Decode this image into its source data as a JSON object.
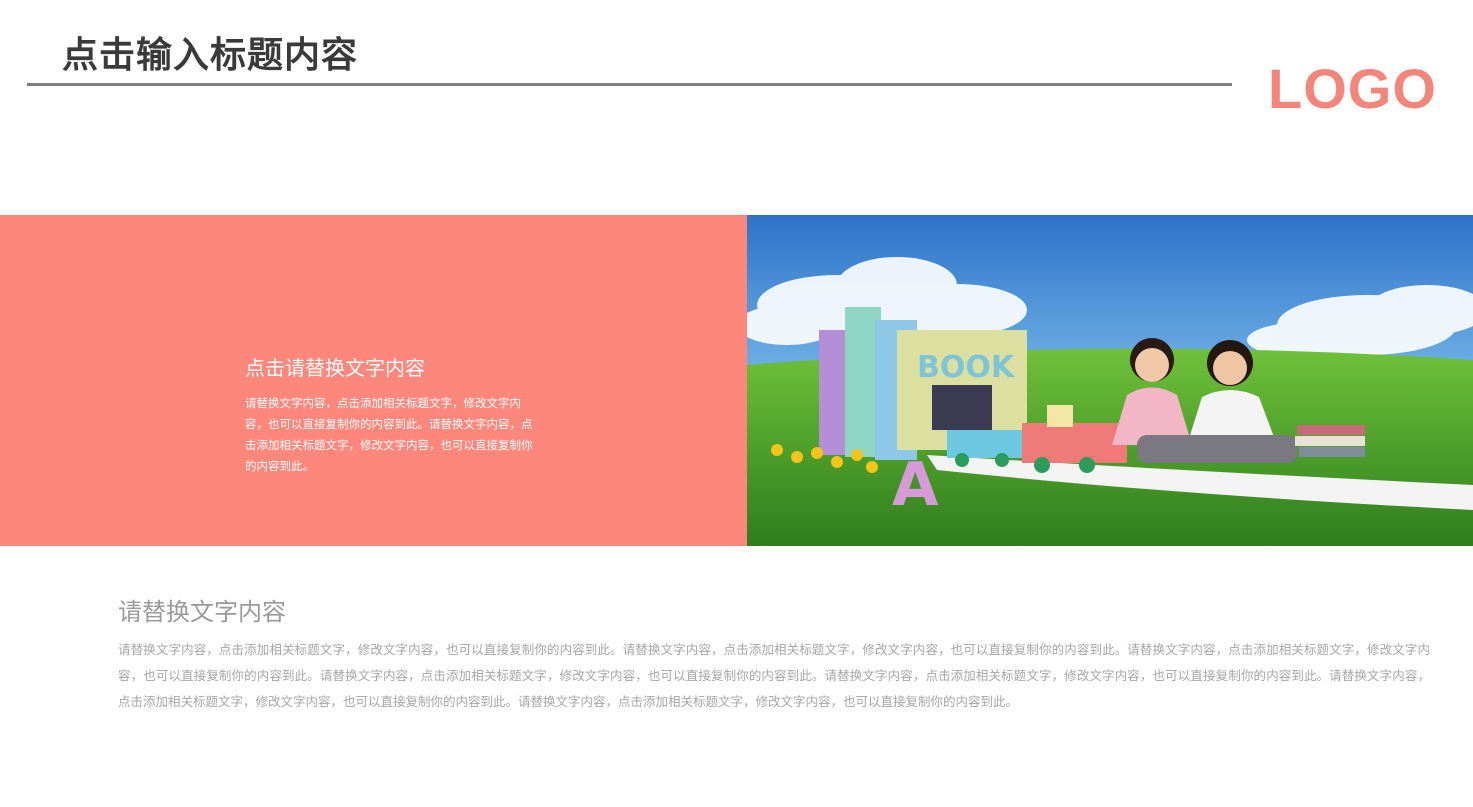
{
  "header": {
    "title": "点击输入标题内容",
    "logo": "LOGO"
  },
  "band": {
    "title": "点击请替换文字内容",
    "body": "请替换文字内容，点击添加相关标题文字，修改文字内容，也可以直接复制你的内容到此。请替换文字内容，点击添加相关标题文字，修改文字内容，也可以直接复制你的内容到此。",
    "image": {
      "icon": "kids-reading-on-grass-photo",
      "book_sign": "BOOK",
      "letter": "A"
    }
  },
  "section": {
    "title": "请替换文字内容",
    "body": "请替换文字内容，点击添加相关标题文字，修改文字内容，也可以直接复制你的内容到此。请替换文字内容，点击添加相关标题文字，修改文字内容，也可以直接复制你的内容到此。请替换文字内容，点击添加相关标题文字，修改文字内容，也可以直接复制你的内容到此。请替换文字内容，点击添加相关标题文字，修改文字内容，也可以直接复制你的内容到此。请替换文字内容，点击添加相关标题文字，修改文字内容，也可以直接复制你的内容到此。请替换文字内容，点击添加相关标题文字，修改文字内容，也可以直接复制你的内容到此。请替换文字内容，点击添加相关标题文字，修改文字内容，也可以直接复制你的内容到此。"
  },
  "colors": {
    "accent": "#fe877c",
    "logo": "#f4857a",
    "title_text": "#3a3a3a",
    "rule": "#7f7f7f"
  }
}
